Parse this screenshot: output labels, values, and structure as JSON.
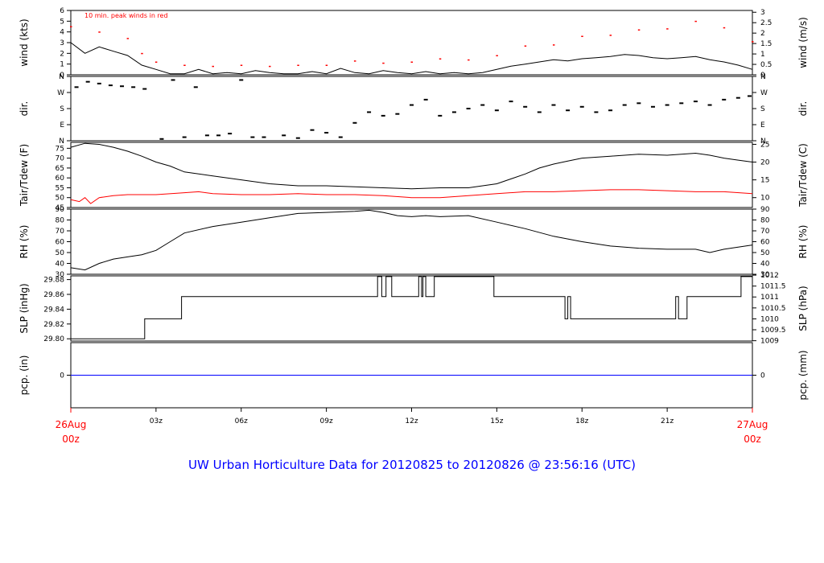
{
  "title": "UW Urban Horticulture Data for 20120825  to  20120826 @ 23:56:16  (UTC)",
  "colors": {
    "frame": "#000000",
    "secondary": "#ff0000",
    "precip": "#0000ff",
    "title": "#0000ff"
  },
  "chart_data": [
    {
      "id": "wind",
      "type": "line",
      "ylabel_left": "wind (kts)",
      "ylabel_right": "wind (m/s)",
      "ylim": [
        0,
        6
      ],
      "yticks_left": [
        0,
        1,
        2,
        3,
        4,
        5,
        6
      ],
      "yticks_right": [
        [
          "0",
          0
        ],
        [
          "0.5",
          0.972
        ],
        [
          "1",
          1.944
        ],
        [
          "1.5",
          2.916
        ],
        [
          "2",
          3.888
        ],
        [
          "2.5",
          4.86
        ],
        [
          "3",
          5.832
        ]
      ],
      "annotation": "10 min. peak winds in red",
      "series": [
        {
          "style": "line",
          "color": "#000000",
          "x": [
            0,
            0.5,
            1,
            1.5,
            2,
            2.5,
            3,
            3.5,
            4,
            4.5,
            5,
            5.5,
            6,
            6.5,
            7,
            7.5,
            8,
            8.5,
            9,
            9.5,
            10,
            10.5,
            11,
            11.5,
            12,
            12.5,
            13,
            13.5,
            14,
            14.5,
            15,
            15.5,
            16,
            16.5,
            17,
            17.5,
            18,
            18.5,
            19,
            19.5,
            20,
            20.5,
            21,
            21.5,
            22,
            22.5,
            23,
            23.5,
            24
          ],
          "values": [
            3.0,
            2.0,
            2.6,
            2.2,
            1.8,
            0.9,
            0.5,
            0.1,
            0.1,
            0.5,
            0.1,
            0.2,
            0.1,
            0.4,
            0.2,
            0.1,
            0.1,
            0.3,
            0.1,
            0.6,
            0.2,
            0.1,
            0.4,
            0.2,
            0.1,
            0.3,
            0.1,
            0.2,
            0.1,
            0.2,
            0.5,
            0.8,
            1.0,
            1.2,
            1.4,
            1.3,
            1.5,
            1.6,
            1.7,
            1.9,
            1.8,
            1.6,
            1.5,
            1.6,
            1.7,
            1.4,
            1.2,
            0.9,
            0.5
          ]
        },
        {
          "style": "points",
          "color": "#ff0000",
          "x": [
            0,
            1,
            2,
            2.5,
            3,
            4,
            5,
            6,
            7,
            8,
            9,
            10,
            11,
            12,
            13,
            14,
            15,
            16,
            17,
            18,
            19,
            20,
            21,
            22,
            23,
            24
          ],
          "values": [
            4.5,
            4.0,
            3.4,
            2.0,
            1.2,
            0.9,
            0.8,
            0.9,
            0.8,
            0.9,
            0.9,
            1.3,
            1.1,
            1.2,
            1.5,
            1.4,
            1.8,
            2.7,
            2.8,
            3.6,
            3.7,
            4.2,
            4.3,
            5.0,
            4.4,
            3.1
          ]
        }
      ]
    },
    {
      "id": "dir",
      "type": "scatter",
      "ylabel_left": "dir.",
      "ylabel_right": "dir.",
      "ylim": [
        0,
        360
      ],
      "ytick_labels": [
        [
          "N",
          0
        ],
        [
          "E",
          90
        ],
        [
          "S",
          180
        ],
        [
          "W",
          270
        ],
        [
          "N",
          360
        ]
      ],
      "series": [
        {
          "style": "points",
          "color": "#000000",
          "x": [
            0.2,
            0.6,
            1.0,
            1.4,
            1.8,
            2.2,
            2.6,
            3.2,
            3.6,
            4.0,
            4.4,
            4.8,
            5.2,
            5.6,
            6.0,
            6.4,
            6.8,
            7.5,
            8.0,
            8.5,
            9.0,
            9.5,
            10.0,
            10.5,
            11.0,
            11.5,
            12.0,
            12.5,
            13.0,
            13.5,
            14.0,
            14.5,
            15.0,
            15.5,
            16.0,
            16.5,
            17.0,
            17.5,
            18.0,
            18.5,
            19.0,
            19.5,
            20.0,
            20.5,
            21.0,
            21.5,
            22.0,
            22.5,
            23.0,
            23.5,
            23.9
          ],
          "values": [
            300,
            330,
            320,
            310,
            305,
            300,
            290,
            10,
            340,
            20,
            300,
            30,
            30,
            40,
            340,
            20,
            20,
            30,
            15,
            60,
            45,
            20,
            100,
            160,
            140,
            150,
            200,
            230,
            140,
            160,
            180,
            200,
            170,
            220,
            190,
            160,
            200,
            170,
            190,
            160,
            170,
            200,
            210,
            190,
            200,
            210,
            220,
            200,
            230,
            240,
            250
          ]
        }
      ]
    },
    {
      "id": "temp",
      "type": "line",
      "ylabel_left": "Tair/Tdew (F)",
      "ylabel_right": "Tair/Tdew (C)",
      "ylim": [
        45,
        78
      ],
      "yticks_left": [
        45,
        50,
        55,
        60,
        65,
        70,
        75
      ],
      "yticks_right": [
        [
          "10",
          50
        ],
        [
          "15",
          59
        ],
        [
          "20",
          68
        ],
        [
          "25",
          77
        ]
      ],
      "series": [
        {
          "style": "line",
          "color": "#000000",
          "x": [
            0,
            0.5,
            1,
            1.5,
            2,
            2.5,
            3,
            3.5,
            4,
            5,
            6,
            7,
            8,
            9,
            10,
            11,
            12,
            13,
            14,
            15,
            16,
            16.5,
            17,
            17.5,
            18,
            19,
            20,
            21,
            22,
            22.5,
            23,
            23.5,
            24
          ],
          "values": [
            75.5,
            77.5,
            77,
            75.5,
            73.5,
            71,
            68,
            66,
            63,
            61,
            59,
            57,
            56,
            56,
            55.5,
            55,
            54.5,
            55,
            55,
            57,
            62,
            65,
            67,
            68.5,
            70,
            71,
            72,
            71.5,
            72.5,
            71.5,
            70,
            69,
            68
          ]
        },
        {
          "style": "line",
          "color": "#ff0000",
          "x": [
            0,
            0.3,
            0.5,
            0.7,
            1,
            1.5,
            2,
            3,
            4,
            4.5,
            5,
            6,
            7,
            8,
            9,
            10,
            11,
            12,
            13,
            14,
            15,
            16,
            17,
            18,
            19,
            20,
            21,
            22,
            23,
            24
          ],
          "values": [
            49,
            48,
            50,
            47,
            50,
            51,
            51.5,
            51.5,
            52.5,
            53,
            52,
            51.5,
            51.5,
            52,
            51.5,
            51.5,
            51,
            50,
            50,
            51,
            52,
            53,
            53,
            53.5,
            54,
            54,
            53.5,
            53,
            53,
            52
          ]
        }
      ]
    },
    {
      "id": "rh",
      "type": "line",
      "ylabel_left": "RH (%)",
      "ylabel_right": "RH (%)",
      "ylim": [
        30,
        90
      ],
      "yticks_left": [
        30,
        40,
        50,
        60,
        70,
        80,
        90
      ],
      "yticks_right": [
        [
          "30",
          30
        ],
        [
          "40",
          40
        ],
        [
          "50",
          50
        ],
        [
          "60",
          60
        ],
        [
          "70",
          70
        ],
        [
          "80",
          80
        ],
        [
          "90",
          90
        ]
      ],
      "series": [
        {
          "style": "line",
          "color": "#000000",
          "x": [
            0,
            0.5,
            1,
            1.5,
            2,
            2.5,
            3,
            3.5,
            4,
            5,
            6,
            7,
            8,
            9,
            10,
            10.5,
            11,
            11.5,
            12,
            12.5,
            13,
            14,
            15,
            16,
            17,
            18,
            19,
            20,
            21,
            22,
            22.5,
            23,
            24
          ],
          "values": [
            36,
            34,
            40,
            44,
            46,
            48,
            52,
            60,
            68,
            74,
            78,
            82,
            86,
            87,
            88,
            89,
            87,
            84,
            83,
            84,
            83,
            84,
            78,
            72,
            65,
            60,
            56,
            54,
            53,
            53,
            50,
            53,
            57
          ]
        }
      ]
    },
    {
      "id": "slp",
      "type": "line",
      "ylabel_left": "SLP (inHg)",
      "ylabel_right": "SLP (hPa)",
      "ylim": [
        29.797,
        29.885
      ],
      "yticks_left": [
        29.8,
        29.82,
        29.84,
        29.86,
        29.88
      ],
      "ytick_format_left": "2dp",
      "yticks_right": [
        [
          "1009",
          29.7974
        ],
        [
          "1009.5",
          29.8122
        ],
        [
          "1010",
          29.8269
        ],
        [
          "1010.5",
          29.8417
        ],
        [
          "1011",
          29.8565
        ],
        [
          "1011.5",
          29.8712
        ],
        [
          "1012",
          29.886
        ]
      ],
      "series": [
        {
          "style": "step",
          "color": "#000000",
          "x": [
            0,
            2.6,
            3.9,
            10.8,
            10.95,
            11.1,
            11.3,
            12.25,
            12.35,
            12.4,
            12.5,
            12.8,
            14.9,
            17.4,
            17.5,
            17.6,
            18.3,
            21.3,
            21.4,
            21.7,
            23.6,
            24
          ],
          "values": [
            29.8,
            29.827,
            29.857,
            29.884,
            29.857,
            29.884,
            29.857,
            29.884,
            29.857,
            29.884,
            29.857,
            29.884,
            29.857,
            29.827,
            29.857,
            29.827,
            29.827,
            29.857,
            29.827,
            29.857,
            29.884,
            29.884
          ]
        }
      ]
    },
    {
      "id": "pcp",
      "type": "line",
      "ylabel_left": "pcp. (in)",
      "ylabel_right": "pcp. (mm)",
      "ylim": [
        -1,
        1
      ],
      "yticks_left": [
        0
      ],
      "yticks_right": [
        [
          "0",
          0
        ]
      ],
      "series": [
        {
          "style": "line",
          "color": "#0000ff",
          "x": [
            0,
            24
          ],
          "values": [
            0,
            0
          ]
        }
      ]
    }
  ],
  "xaxis": {
    "range": [
      0,
      24
    ],
    "ticks": [
      [
        "03z",
        3
      ],
      [
        "06z",
        6
      ],
      [
        "09z",
        9
      ],
      [
        "12z",
        12
      ],
      [
        "15z",
        15
      ],
      [
        "18z",
        18
      ],
      [
        "21z",
        21
      ]
    ],
    "start_label": [
      "26Aug",
      "00z"
    ],
    "end_label": [
      "27Aug",
      "00z"
    ]
  }
}
